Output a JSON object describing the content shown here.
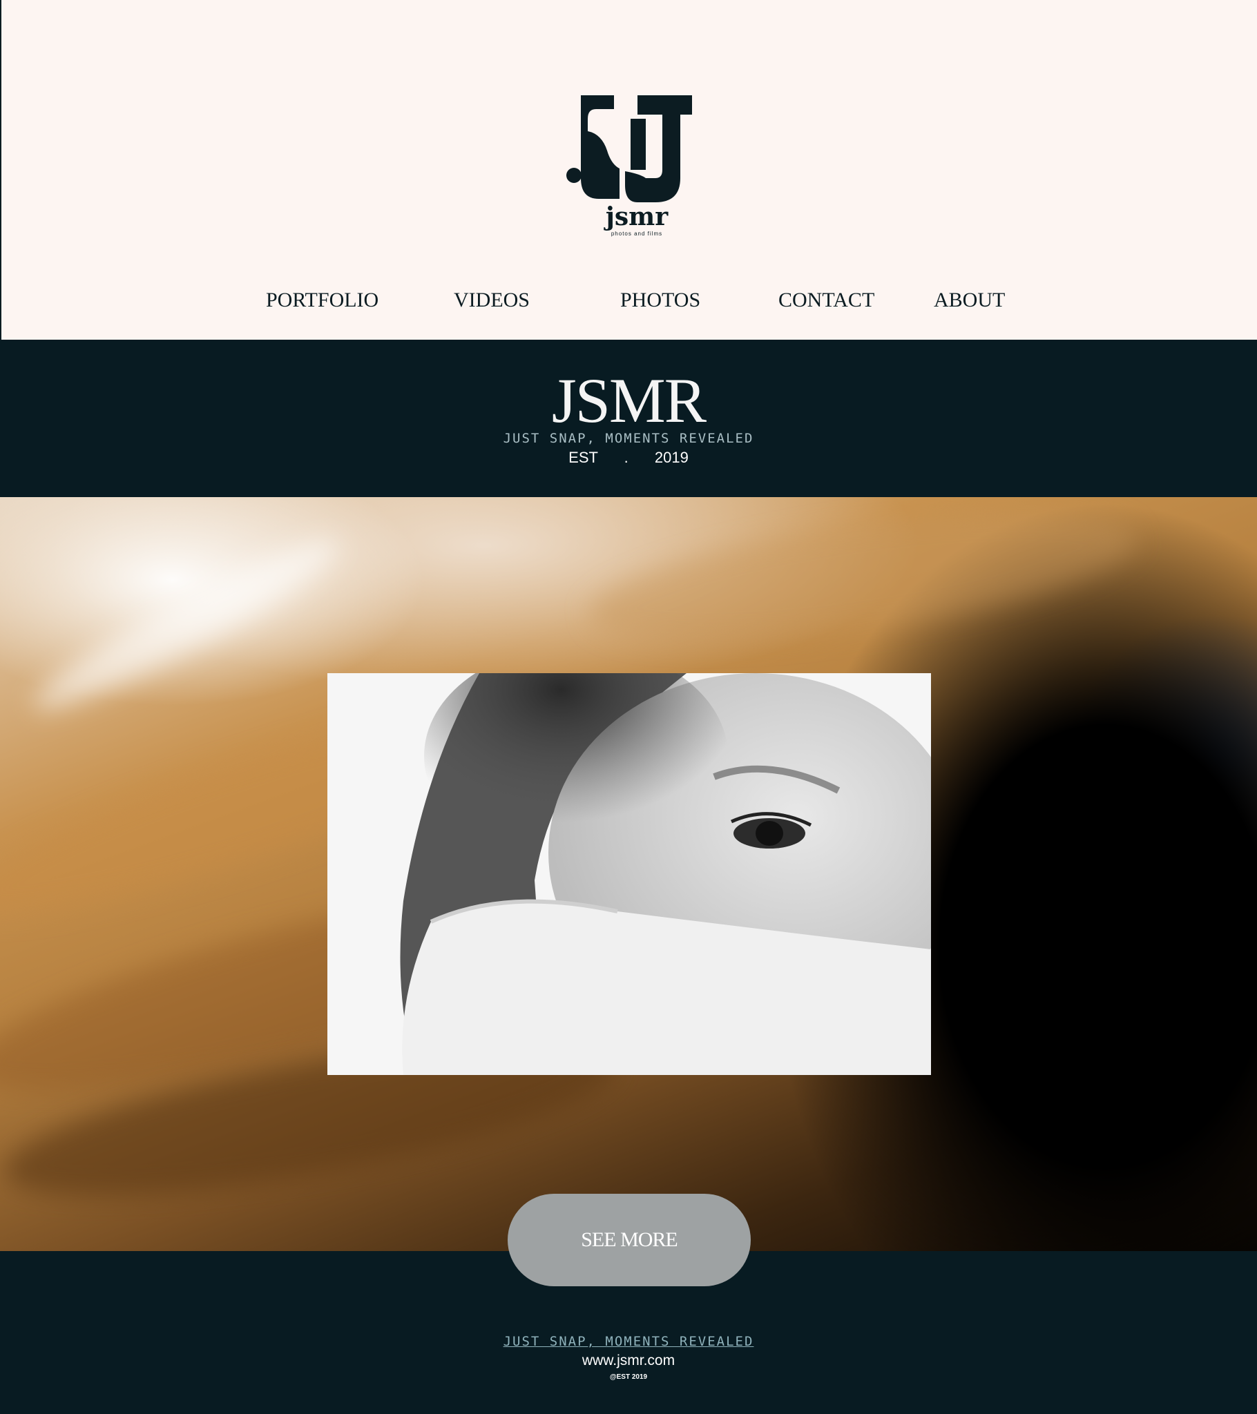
{
  "header": {
    "logo_word": "jsmr",
    "logo_sub": "photos and films"
  },
  "nav": {
    "items": [
      {
        "label": "PORTFOLIO"
      },
      {
        "label": "VIDEOS"
      },
      {
        "label": "PHOTOS"
      },
      {
        "label": "CONTACT"
      },
      {
        "label": "ABOUT"
      }
    ]
  },
  "brand": {
    "title": "JSMR",
    "tagline": "JUST SNAP, MOMENTS REVEALED",
    "est": "EST . 2019"
  },
  "hero": {
    "button_label": "SEE MORE"
  },
  "footer": {
    "tagline": "JUST SNAP, MOMENTS REVEALED",
    "url": "www.jsmr.com",
    "est": "@EST 2019"
  },
  "colors": {
    "navy": "#081b22",
    "cream": "#fdf5f2",
    "button": "#9ea2a3",
    "link": "#8fb2bb"
  }
}
